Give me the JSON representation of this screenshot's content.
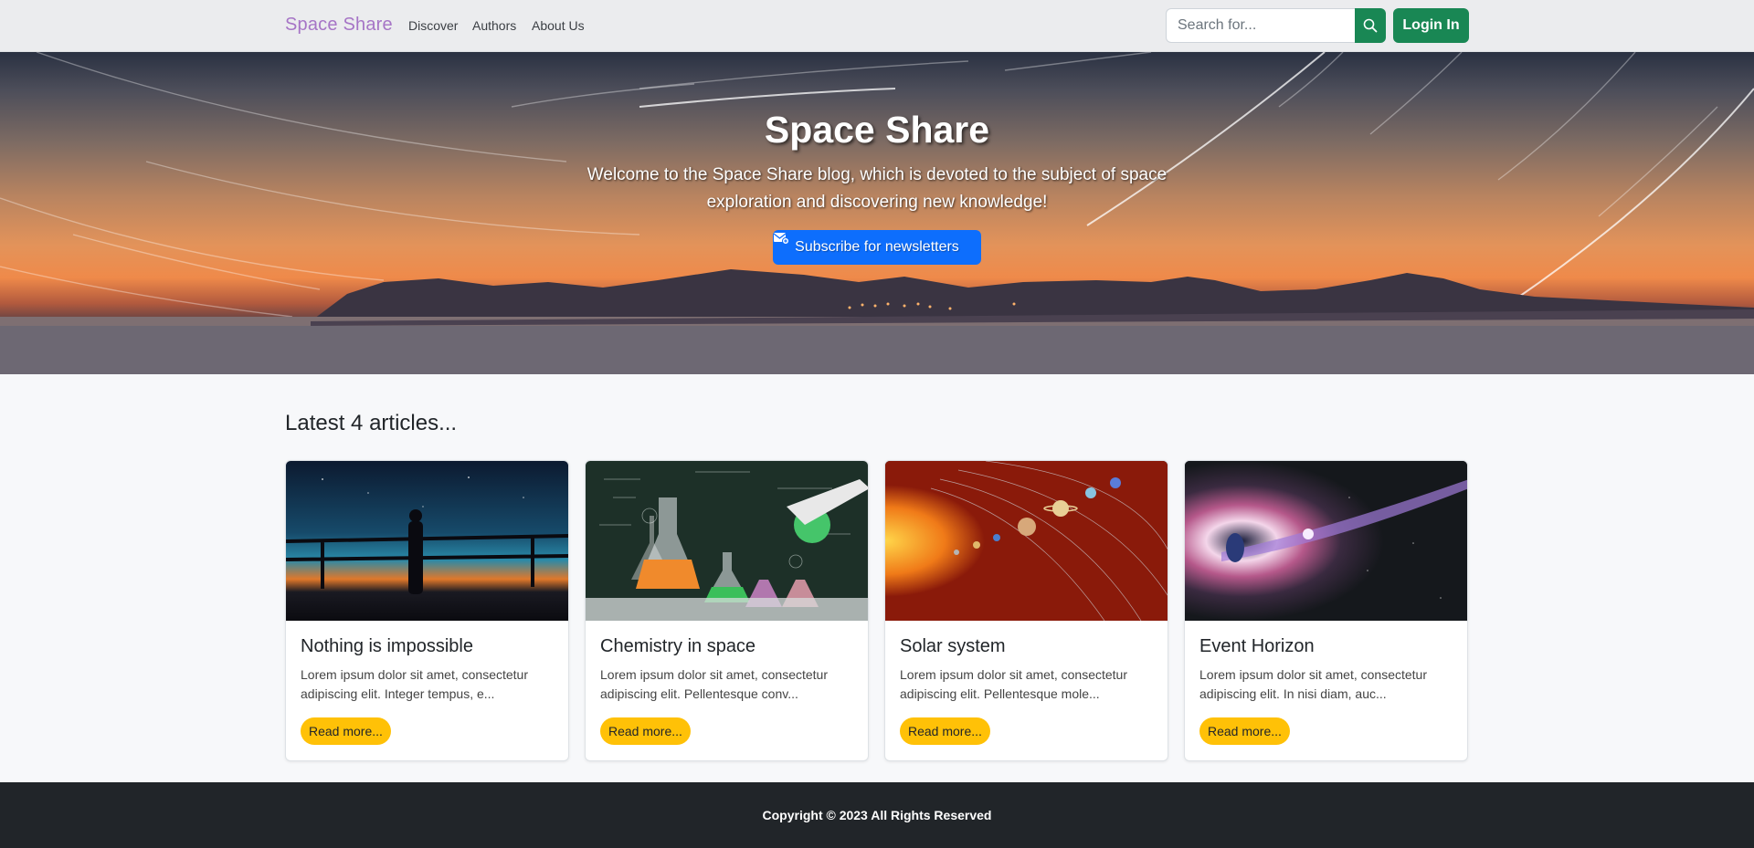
{
  "navbar": {
    "brand": "Space Share",
    "links": [
      "Discover",
      "Authors",
      "About Us"
    ],
    "search_placeholder": "Search for...",
    "login_label": "Login In"
  },
  "hero": {
    "title": "Space Share",
    "subtitle": "Welcome to the Space Share blog, which is devoted to the subject of space exploration and discovering new knowledge!",
    "subscribe_label": "Subscribe for newsletters"
  },
  "articles": {
    "heading": "Latest 4 articles...",
    "items": [
      {
        "title": "Nothing is impossible",
        "excerpt": "Lorem ipsum dolor sit amet, consectetur adipiscing elit. Integer tempus, e...",
        "button": "Read more..."
      },
      {
        "title": "Chemistry in space",
        "excerpt": "Lorem ipsum dolor sit amet, consectetur adipiscing elit. Pellentesque conv...",
        "button": "Read more..."
      },
      {
        "title": "Solar system",
        "excerpt": "Lorem ipsum dolor sit amet, consectetur adipiscing elit. Pellentesque mole...",
        "button": "Read more..."
      },
      {
        "title": "Event Horizon",
        "excerpt": "Lorem ipsum dolor sit amet, consectetur adipiscing elit. In nisi diam, auc...",
        "button": "Read more..."
      }
    ]
  },
  "footer": {
    "copyright": "Copyright © 2023 All Rights Reserved"
  },
  "colors": {
    "brand": "#a675c6",
    "success": "#198754",
    "primary": "#0d6efd",
    "warning": "#ffc107",
    "footer_bg": "#212529"
  },
  "icons": {
    "search": "search-icon",
    "subscribe": "mail-icon"
  }
}
